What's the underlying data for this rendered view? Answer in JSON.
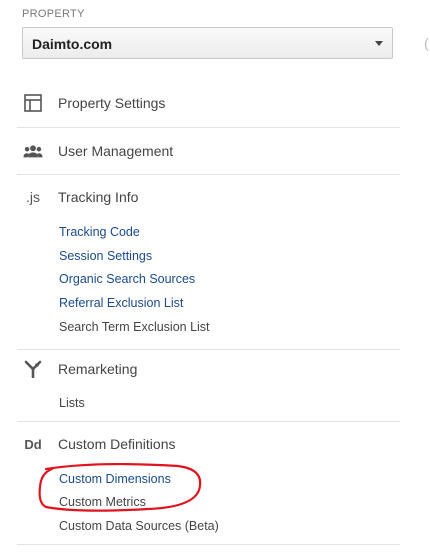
{
  "property": {
    "label": "PROPERTY",
    "selected": "Daimto.com"
  },
  "sections": {
    "property_settings": {
      "title": "Property Settings",
      "icon": "layout-icon"
    },
    "user_management": {
      "title": "User Management",
      "icon": "users-icon"
    },
    "tracking_info": {
      "title": "Tracking Info",
      "icon": "js-icon",
      "icon_text": ".js",
      "items": [
        "Tracking Code",
        "Session Settings",
        "Organic Search Sources",
        "Referral Exclusion List",
        "Search Term Exclusion List"
      ]
    },
    "remarketing": {
      "title": "Remarketing",
      "icon": "remarketing-icon",
      "items": [
        "Lists"
      ]
    },
    "custom_definitions": {
      "title": "Custom Definitions",
      "icon": "dd-icon",
      "icon_text": "Dd",
      "items": [
        "Custom Dimensions",
        "Custom Metrics",
        "Custom Data Sources (Beta)"
      ]
    }
  },
  "colors": {
    "link": "#1a4b8c",
    "annotation": "#e0141e"
  }
}
